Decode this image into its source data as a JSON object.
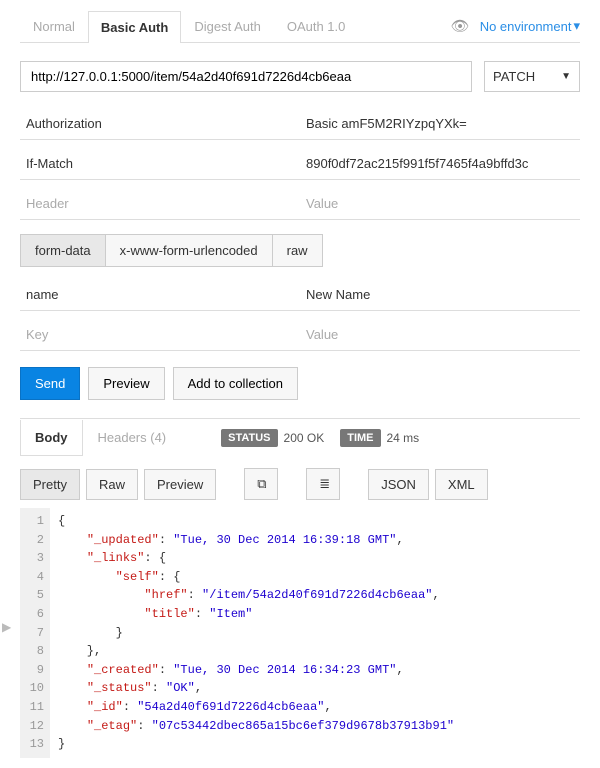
{
  "auth_tabs": {
    "normal": "Normal",
    "basic": "Basic Auth",
    "digest": "Digest Auth",
    "oauth": "OAuth 1.0"
  },
  "env": {
    "label": "No environment"
  },
  "request": {
    "url": "http://127.0.0.1:5000/item/54a2d40f691d7226d4cb6eaa",
    "method": "PATCH"
  },
  "headers": [
    {
      "key": "Authorization",
      "value": "Basic amF5M2RIYzpqYXk="
    },
    {
      "key": "If-Match",
      "value": "890f0df72ac215f991f5f7465f4a9bffd3c"
    }
  ],
  "header_placeholder": {
    "key": "Header",
    "value": "Value"
  },
  "body_types": {
    "form": "form-data",
    "urlenc": "x-www-form-urlencoded",
    "raw": "raw"
  },
  "body_rows": [
    {
      "key": "name",
      "value": "New Name"
    }
  ],
  "body_placeholder": {
    "key": "Key",
    "value": "Value"
  },
  "buttons": {
    "send": "Send",
    "preview": "Preview",
    "add": "Add to collection"
  },
  "resp_tabs": {
    "body": "Body",
    "headers": "Headers (4)"
  },
  "status": {
    "label": "STATUS",
    "value": "200 OK",
    "time_label": "TIME",
    "time_value": "24 ms"
  },
  "fmt": {
    "pretty": "Pretty",
    "raw": "Raw",
    "preview": "Preview",
    "json": "JSON",
    "xml": "XML"
  },
  "icons": {
    "copy_glyph": "⧉",
    "wrap_glyph": "≣"
  },
  "code_lines": [
    "{",
    "    \"_updated\": \"Tue, 30 Dec 2014 16:39:18 GMT\",",
    "    \"_links\": {",
    "        \"self\": {",
    "            \"href\": \"/item/54a2d40f691d7226d4cb6eaa\",",
    "            \"title\": \"Item\"",
    "        }",
    "    },",
    "    \"_created\": \"Tue, 30 Dec 2014 16:34:23 GMT\",",
    "    \"_status\": \"OK\",",
    "    \"_id\": \"54a2d40f691d7226d4cb6eaa\",",
    "    \"_etag\": \"07c53442dbec865a15bc6ef379d9678b37913b91\"",
    "}"
  ]
}
